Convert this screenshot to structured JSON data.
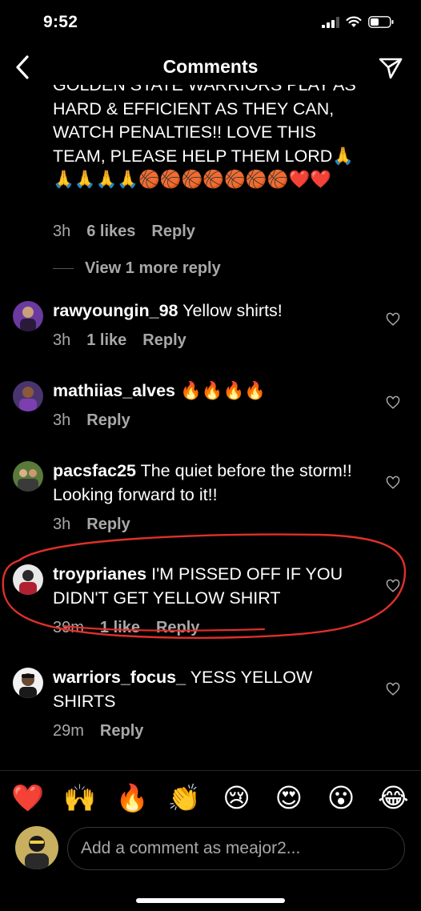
{
  "status_bar": {
    "time": "9:52"
  },
  "header": {
    "title": "Comments"
  },
  "partial_comment": {
    "text": "GOLDEN STATE WARRIORS PLAY AS HARD & EFFICIENT AS THEY CAN, WATCH PENALTIES!! LOVE THIS TEAM, PLEASE HELP THEM LORD🙏🙏🙏🙏🙏🏀🏀🏀🏀🏀🏀🏀❤️❤️",
    "time": "3h",
    "likes": "6 likes",
    "reply": "Reply"
  },
  "view_more": "View 1 more reply",
  "comments": [
    {
      "username": "rawyoungin_98",
      "text": "Yellow shirts!",
      "time": "3h",
      "likes": "1 like",
      "reply": "Reply"
    },
    {
      "username": "mathiias_alves",
      "text": "🔥🔥🔥🔥",
      "time": "3h",
      "likes": "",
      "reply": "Reply"
    },
    {
      "username": "pacsfac25",
      "text": "The quiet before the storm!! Looking forward to it!!",
      "time": "3h",
      "likes": "",
      "reply": "Reply"
    },
    {
      "username": "troyprianes",
      "text": "I'M PISSED OFF IF YOU DIDN'T GET YELLOW SHIRT",
      "time": "39m",
      "likes": "1 like",
      "reply": "Reply"
    },
    {
      "username": "warriors_focus_",
      "text": "YESS YELLOW SHIRTS",
      "time": "29m",
      "likes": "",
      "reply": "Reply"
    }
  ],
  "emoji_bar": [
    "❤️",
    "🙌",
    "🔥",
    "👏",
    "😢",
    "😍",
    "😮",
    "😂"
  ],
  "composer": {
    "placeholder": "Add a comment as meajor2..."
  },
  "colors": {
    "background": "#000000",
    "secondary_text": "#a8a8a8",
    "annotation": "#e0302a",
    "heart_red": "#ed4956"
  }
}
